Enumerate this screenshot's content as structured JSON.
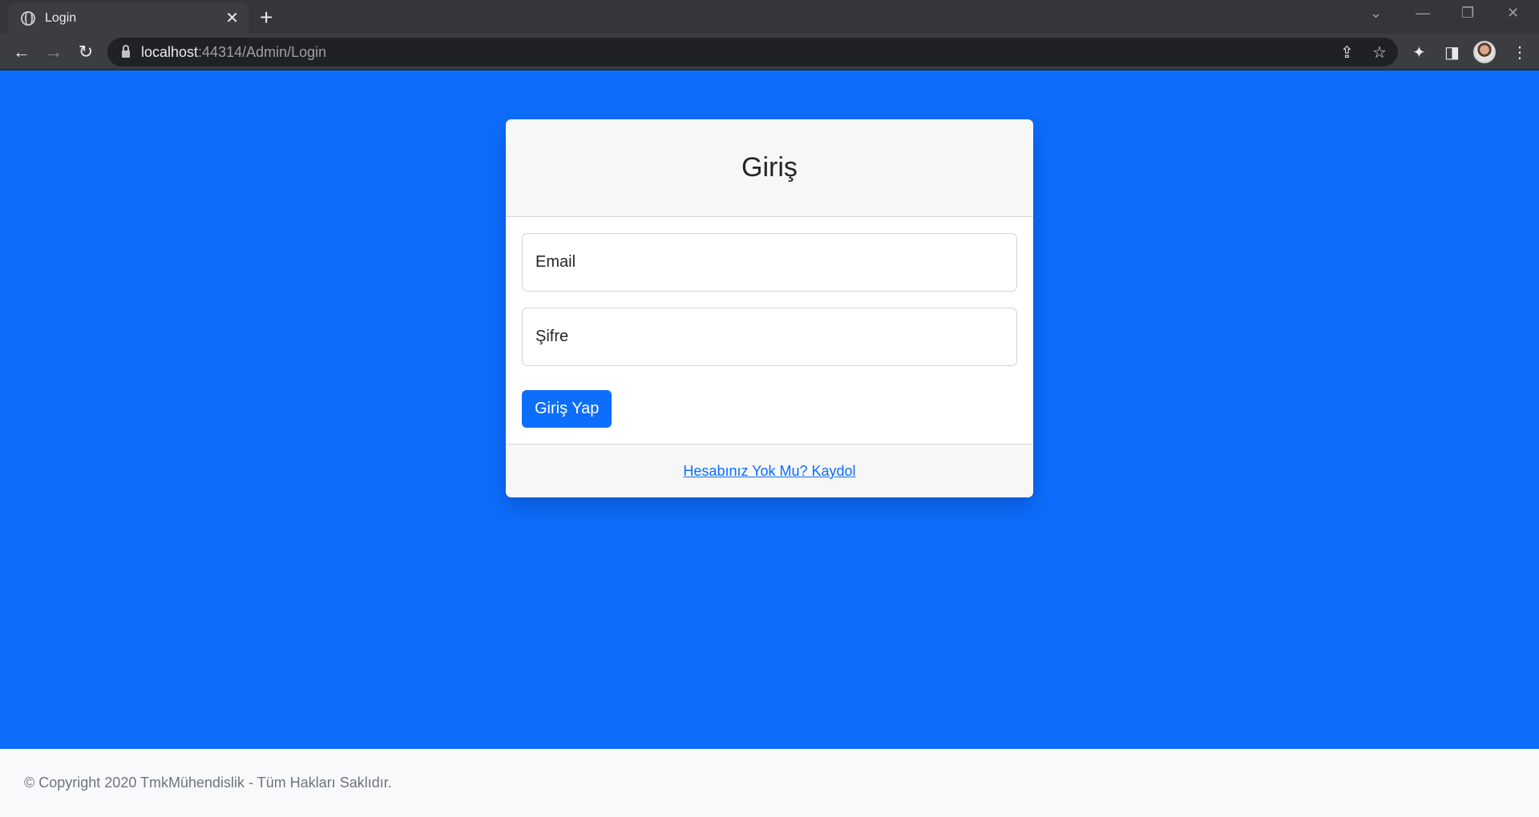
{
  "browser": {
    "tab_title": "Login",
    "tab_close": "✕",
    "new_tab": "+",
    "url_host": "localhost",
    "url_rest": ":44314/Admin/Login",
    "window_controls": {
      "dropdown": "⌄",
      "minimize": "—",
      "restore": "❐",
      "close": "✕"
    },
    "nav": {
      "back": "←",
      "forward": "→",
      "reload": "↻"
    },
    "icons": {
      "share": "⇪",
      "bookmark": "☆",
      "extensions": "✦",
      "side_panel": "◨",
      "menu": "⋮"
    }
  },
  "login": {
    "title": "Giriş",
    "email_placeholder": "Email",
    "password_placeholder": "Şifre",
    "submit_label": "Giriş Yap",
    "register_link": "Hesabınız Yok Mu? Kaydol"
  },
  "footer": {
    "copyright": "© Copyright 2020 TmkMühendislik - Tüm Hakları Saklıdır."
  },
  "colors": {
    "page_background": "#0d6efd",
    "primary_button": "#0d6efd",
    "footer_background": "#f8f9fa"
  }
}
